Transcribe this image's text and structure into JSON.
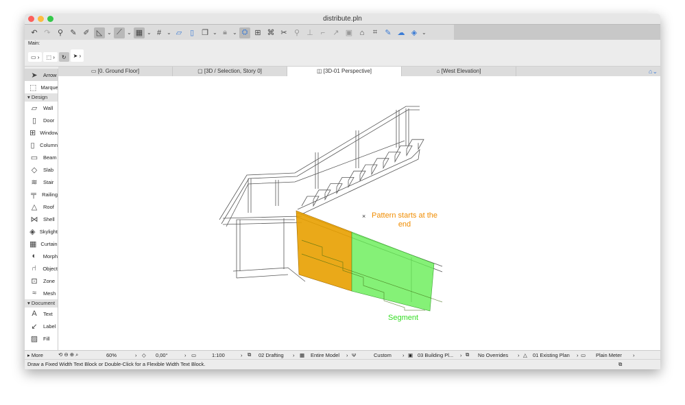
{
  "window": {
    "title": "distribute.pln",
    "colors": {
      "close": "#fc605c",
      "minimize": "#fdbc40",
      "zoom": "#34c84a"
    }
  },
  "toolbar": {
    "icons": [
      "undo-icon",
      "redo-icon",
      "find-select-icon",
      "pick-up-icon",
      "inject-icon",
      "guide-line-icon",
      "snap-guide-icon",
      "grid-snap-icon",
      "grid-icon",
      "slanted-plane-icon",
      "vertical-plane-icon",
      "layer-icon",
      "lock-icon",
      "trace-icon",
      "dimension-icon",
      "intersect-icon",
      "split-icon",
      "adjust-icon",
      "elevate-icon",
      "fillet-icon",
      "curve-icon",
      "resize-icon",
      "house-icon",
      "group-icon",
      "edit-icon",
      "cloud-icon",
      "render-icon"
    ]
  },
  "main_bar": {
    "label": "Main:"
  },
  "tabs": [
    {
      "label": "[0. Ground Floor]"
    },
    {
      "label": "[3D / Selection, Story 0]"
    },
    {
      "label": "[3D-01 Perspective]",
      "active": true
    },
    {
      "label": "[West Elevation]"
    },
    {
      "label": ""
    }
  ],
  "sidebar": {
    "top": [
      {
        "label": "Arrow",
        "icon": "arrow-icon",
        "selected": true
      },
      {
        "label": "Marquee",
        "icon": "marquee-icon"
      }
    ],
    "design_header": "Design",
    "design": [
      {
        "label": "Wall",
        "icon": "wall-icon"
      },
      {
        "label": "Door",
        "icon": "door-icon"
      },
      {
        "label": "Window",
        "icon": "window-icon"
      },
      {
        "label": "Column",
        "icon": "column-icon"
      },
      {
        "label": "Beam",
        "icon": "beam-icon"
      },
      {
        "label": "Slab",
        "icon": "slab-icon"
      },
      {
        "label": "Stair",
        "icon": "stair-icon"
      },
      {
        "label": "Railing",
        "icon": "railing-icon"
      },
      {
        "label": "Roof",
        "icon": "roof-icon"
      },
      {
        "label": "Shell",
        "icon": "shell-icon"
      },
      {
        "label": "Skylight",
        "icon": "skylight-icon"
      },
      {
        "label": "Curtain Wall",
        "icon": "curtain-wall-icon"
      },
      {
        "label": "Morph",
        "icon": "morph-icon"
      },
      {
        "label": "Object",
        "icon": "object-icon"
      },
      {
        "label": "Zone",
        "icon": "zone-icon"
      },
      {
        "label": "Mesh",
        "icon": "mesh-icon"
      }
    ],
    "document_header": "Document",
    "document": [
      {
        "label": "Text",
        "icon": "text-icon"
      },
      {
        "label": "Label",
        "icon": "label-icon"
      },
      {
        "label": "Fill",
        "icon": "fill-icon"
      }
    ],
    "more": "More"
  },
  "canvas": {
    "annotation_orange": "Pattern starts at the end",
    "annotation_green": "Segment",
    "orange": "#e8a000",
    "green": "#66ee55"
  },
  "status": {
    "zoom": "60%",
    "angle": "0,00°",
    "scale": "1:100",
    "layer": "02 Drafting",
    "model": "Entire Model",
    "pen": "Custom",
    "view": "03 Building Pl...",
    "override": "No Overrides",
    "renovation": "01 Existing Plan",
    "dimension": "Plain Meter"
  },
  "message": "Draw a Fixed Width Text Block or Double-Click for a Flexible Width Text Block."
}
